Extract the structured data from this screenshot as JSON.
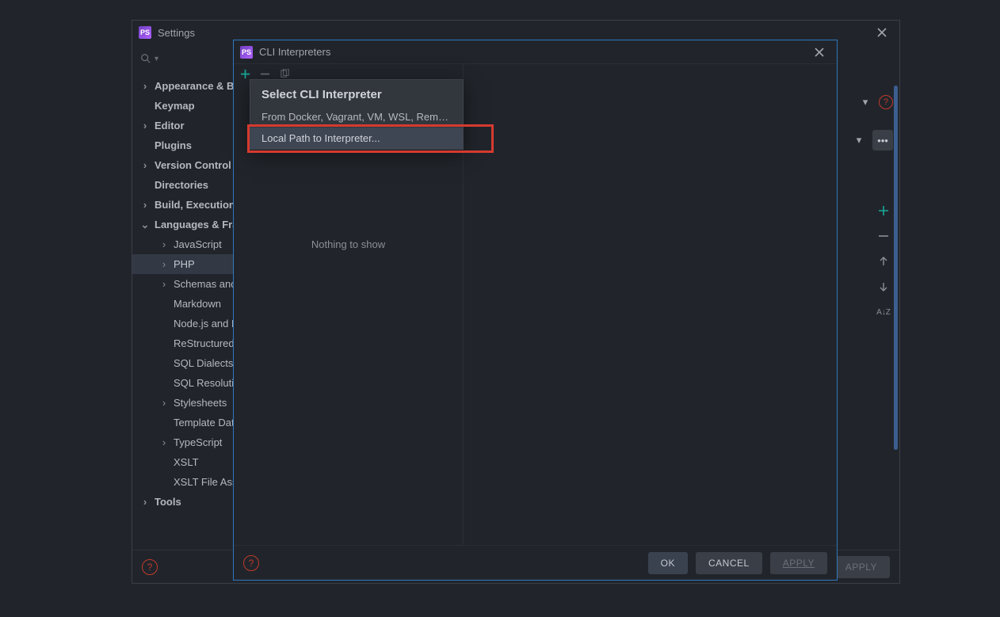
{
  "settings": {
    "title": "Settings",
    "tree": [
      {
        "label": "Appearance & Behavior",
        "chev": ">",
        "lvl": 0,
        "bold": true
      },
      {
        "label": "Keymap",
        "chev": "",
        "lvl": 0,
        "bold": true
      },
      {
        "label": "Editor",
        "chev": ">",
        "lvl": 0,
        "bold": true
      },
      {
        "label": "Plugins",
        "chev": "",
        "lvl": 0,
        "bold": true
      },
      {
        "label": "Version Control",
        "chev": ">",
        "lvl": 0,
        "bold": true
      },
      {
        "label": "Directories",
        "chev": "",
        "lvl": 0,
        "bold": true
      },
      {
        "label": "Build, Execution, Deployment",
        "chev": ">",
        "lvl": 0,
        "bold": true
      },
      {
        "label": "Languages & Frameworks",
        "chev": "v",
        "lvl": 0,
        "bold": true
      },
      {
        "label": "JavaScript",
        "chev": ">",
        "lvl": 1
      },
      {
        "label": "PHP",
        "chev": ">",
        "lvl": 1,
        "sel": true
      },
      {
        "label": "Schemas and DTDs",
        "chev": ">",
        "lvl": 1
      },
      {
        "label": "Markdown",
        "chev": "",
        "lvl": 1
      },
      {
        "label": "Node.js and NPM",
        "chev": "",
        "lvl": 1
      },
      {
        "label": "ReStructured Text",
        "chev": "",
        "lvl": 1
      },
      {
        "label": "SQL Dialects",
        "chev": "",
        "lvl": 1
      },
      {
        "label": "SQL Resolution Scopes",
        "chev": "",
        "lvl": 1
      },
      {
        "label": "Stylesheets",
        "chev": ">",
        "lvl": 1
      },
      {
        "label": "Template Data Languages",
        "chev": "",
        "lvl": 1
      },
      {
        "label": "TypeScript",
        "chev": ">",
        "lvl": 1
      },
      {
        "label": "XSLT",
        "chev": "",
        "lvl": 1
      },
      {
        "label": "XSLT File Associations",
        "chev": "",
        "lvl": 1
      },
      {
        "label": "Tools",
        "chev": ">",
        "lvl": 0,
        "bold": true
      }
    ],
    "buttons": {
      "apply": "APPLY"
    }
  },
  "cli": {
    "title": "CLI Interpreters",
    "empty": "Nothing to show",
    "buttons": {
      "ok": "OK",
      "cancel": "CANCEL",
      "apply": "APPLY"
    }
  },
  "popup": {
    "title": "Select CLI Interpreter",
    "opt1": "From Docker, Vagrant, VM, WSL, Remote...",
    "opt2": "Local Path to Interpreter..."
  }
}
